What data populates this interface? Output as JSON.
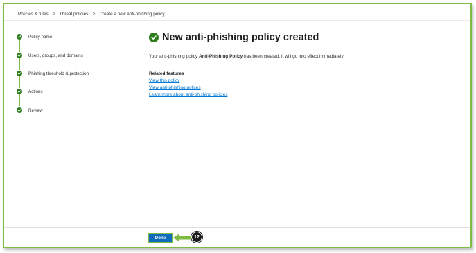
{
  "breadcrumb": {
    "items": [
      "Policies & rules",
      "Threat policies",
      "Create a new anti-phishing policy"
    ],
    "separator": ">"
  },
  "steps": [
    {
      "label": "Policy name",
      "status": "complete"
    },
    {
      "label": "Users, groups, and domains",
      "status": "complete"
    },
    {
      "label": "Phishing threshold & protection",
      "status": "complete"
    },
    {
      "label": "Actions",
      "status": "complete"
    },
    {
      "label": "Review",
      "status": "complete"
    }
  ],
  "main": {
    "title": "New anti-phishing policy created",
    "message_prefix": "Your anti-phishing policy ",
    "policy_name": "Anti-Phishing Policy",
    "message_suffix": " has been created. It will go into effect immediately",
    "related_title": "Related features",
    "links": [
      "View this policy",
      "View anti-phishing polices",
      "Learn more about anti-phishing policies"
    ]
  },
  "footer": {
    "done_label": "Done"
  },
  "callout": {
    "number": "12"
  },
  "colors": {
    "accent_green": "#7dbb42",
    "success_green": "#2e7d1f",
    "primary_blue": "#0f6cbd",
    "link_blue": "#0078d4"
  },
  "icons": [
    "checkmark-circle-icon",
    "chevron-right-icon",
    "arrow-left-icon"
  ]
}
